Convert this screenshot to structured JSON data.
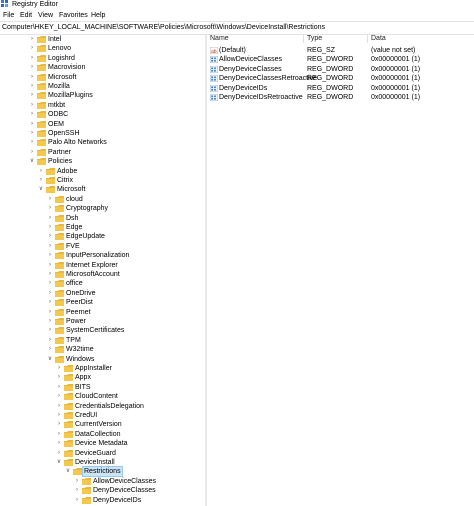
{
  "window": {
    "title": "Registry Editor"
  },
  "menu": [
    "File",
    "Edit",
    "View",
    "Favorites",
    "Help"
  ],
  "address": "Computer\\HKEY_LOCAL_MACHINE\\SOFTWARE\\Policies\\Microsoft\\Windows\\DeviceInstall\\Restrictions",
  "tree": [
    {
      "label": "Intel",
      "level": 0,
      "expanded": false
    },
    {
      "label": "Lenovo",
      "level": 0,
      "expanded": false
    },
    {
      "label": "Logishrd",
      "level": 0,
      "expanded": false
    },
    {
      "label": "Macrovision",
      "level": 0,
      "expanded": false
    },
    {
      "label": "Microsoft",
      "level": 0,
      "expanded": false
    },
    {
      "label": "Mozilla",
      "level": 0,
      "expanded": false
    },
    {
      "label": "MozillaPlugins",
      "level": 0,
      "expanded": false
    },
    {
      "label": "mtkbt",
      "level": 0,
      "expanded": false
    },
    {
      "label": "ODBC",
      "level": 0,
      "expanded": false
    },
    {
      "label": "OEM",
      "level": 0,
      "expanded": false
    },
    {
      "label": "OpenSSH",
      "level": 0,
      "expanded": false
    },
    {
      "label": "Palo Alto Networks",
      "level": 0,
      "expanded": false
    },
    {
      "label": "Partner",
      "level": 0,
      "expanded": false
    },
    {
      "label": "Policies",
      "level": 0,
      "expanded": true
    },
    {
      "label": "Adobe",
      "level": 1,
      "expanded": false
    },
    {
      "label": "Citrix",
      "level": 1,
      "expanded": false
    },
    {
      "label": "Microsoft",
      "level": 1,
      "expanded": true
    },
    {
      "label": "cloud",
      "level": 2,
      "expanded": false
    },
    {
      "label": "Cryptography",
      "level": 2,
      "expanded": false
    },
    {
      "label": "Dsh",
      "level": 2,
      "expanded": false
    },
    {
      "label": "Edge",
      "level": 2,
      "expanded": false
    },
    {
      "label": "EdgeUpdate",
      "level": 2,
      "expanded": false
    },
    {
      "label": "FVE",
      "level": 2,
      "expanded": false
    },
    {
      "label": "InputPersonalization",
      "level": 2,
      "expanded": false
    },
    {
      "label": "Internet Explorer",
      "level": 2,
      "expanded": false
    },
    {
      "label": "MicrosoftAccount",
      "level": 2,
      "expanded": false
    },
    {
      "label": "office",
      "level": 2,
      "expanded": false
    },
    {
      "label": "OneDrive",
      "level": 2,
      "expanded": false
    },
    {
      "label": "PeerDist",
      "level": 2,
      "expanded": false
    },
    {
      "label": "Peernet",
      "level": 2,
      "expanded": false
    },
    {
      "label": "Power",
      "level": 2,
      "expanded": false
    },
    {
      "label": "SystemCertificates",
      "level": 2,
      "expanded": false
    },
    {
      "label": "TPM",
      "level": 2,
      "expanded": false
    },
    {
      "label": "W32time",
      "level": 2,
      "expanded": false
    },
    {
      "label": "Windows",
      "level": 2,
      "expanded": true
    },
    {
      "label": "AppInstaller",
      "level": 3,
      "expanded": false
    },
    {
      "label": "Appx",
      "level": 3,
      "expanded": false
    },
    {
      "label": "BITS",
      "level": 3,
      "expanded": false
    },
    {
      "label": "CloudContent",
      "level": 3,
      "expanded": false
    },
    {
      "label": "CredentialsDelegation",
      "level": 3,
      "expanded": false
    },
    {
      "label": "CredUI",
      "level": 3,
      "expanded": false
    },
    {
      "label": "CurrentVersion",
      "level": 3,
      "expanded": false
    },
    {
      "label": "DataCollection",
      "level": 3,
      "expanded": false
    },
    {
      "label": "Device Metadata",
      "level": 3,
      "expanded": false
    },
    {
      "label": "DeviceGuard",
      "level": 3,
      "expanded": false
    },
    {
      "label": "DeviceInstall",
      "level": 3,
      "expanded": true
    },
    {
      "label": "Restrictions",
      "level": 4,
      "expanded": true,
      "selected": true
    },
    {
      "label": "AllowDeviceClasses",
      "level": 5,
      "expanded": false
    },
    {
      "label": "DenyDeviceClasses",
      "level": 5,
      "expanded": false
    },
    {
      "label": "DenyDeviceIDs",
      "level": 5,
      "expanded": false
    }
  ],
  "list": {
    "headers": [
      "Name",
      "Type",
      "Data"
    ],
    "rows": [
      {
        "name": "(Default)",
        "type": "REG_SZ",
        "data": "(value not set)",
        "icon": "string-value-icon"
      },
      {
        "name": "AllowDeviceClasses",
        "type": "REG_DWORD",
        "data": "0x00000001 (1)",
        "icon": "dword-value-icon"
      },
      {
        "name": "DenyDeviceClasses",
        "type": "REG_DWORD",
        "data": "0x00000001 (1)",
        "icon": "dword-value-icon"
      },
      {
        "name": "DenyDeviceClassesRetroactive",
        "type": "REG_DWORD",
        "data": "0x00000001 (1)",
        "icon": "dword-value-icon"
      },
      {
        "name": "DenyDeviceIDs",
        "type": "REG_DWORD",
        "data": "0x00000001 (1)",
        "icon": "dword-value-icon"
      },
      {
        "name": "DenyDeviceIDsRetroactive",
        "type": "REG_DWORD",
        "data": "0x00000001 (1)",
        "icon": "dword-value-icon"
      }
    ]
  },
  "colors": {
    "folder": "#e8b83c",
    "selection": "#cce4f7",
    "dword_icon": "#2b6cb8",
    "string_icon": "#c0392b"
  }
}
